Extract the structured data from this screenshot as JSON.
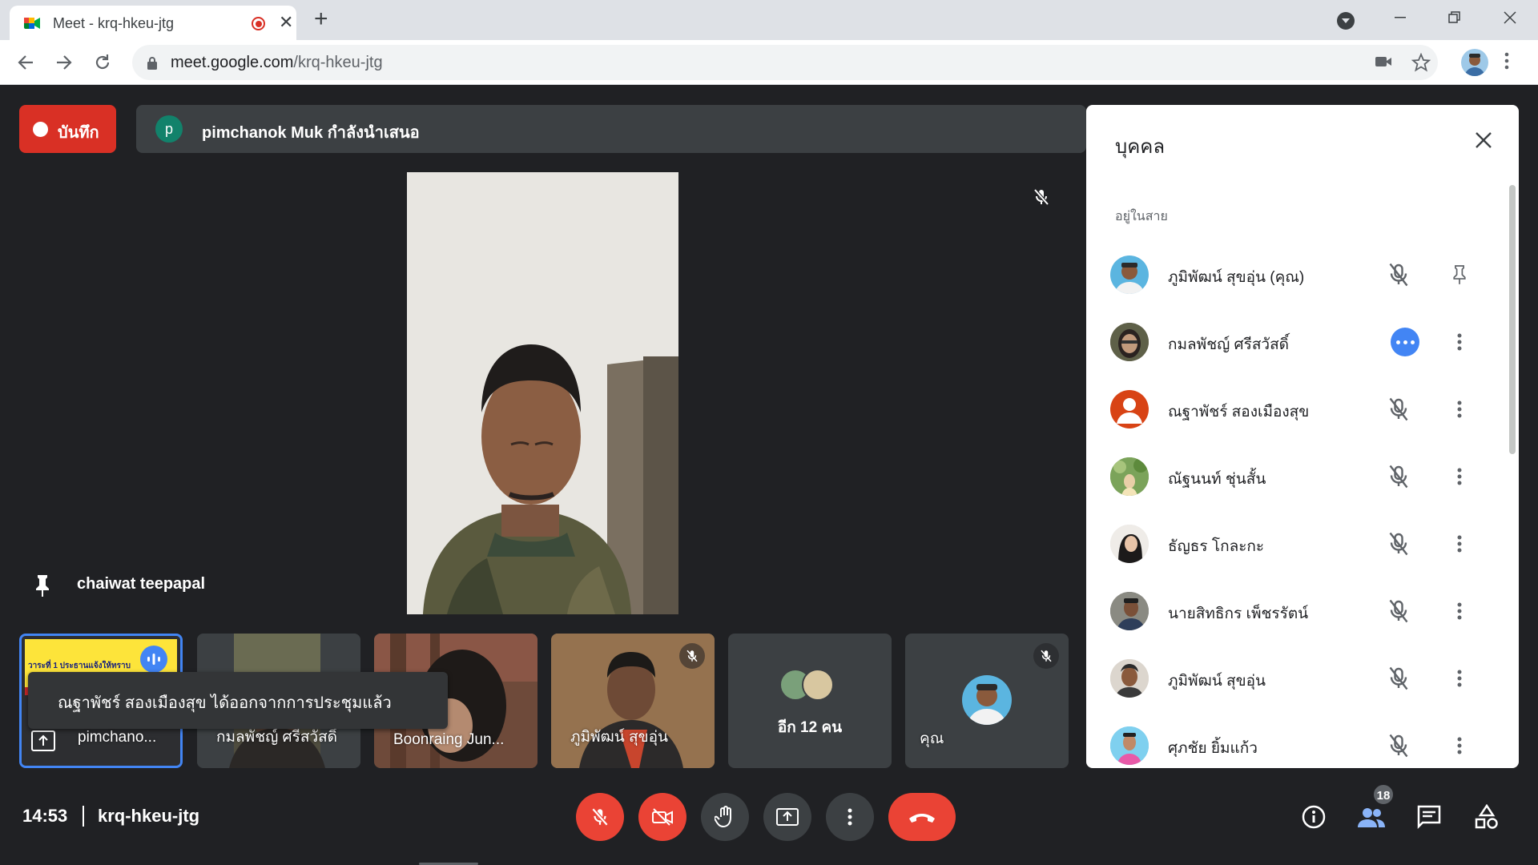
{
  "browser": {
    "tab_title": "Meet - krq-hkeu-jtg",
    "url_host": "meet.google.com",
    "url_path": "/krq-hkeu-jtg"
  },
  "meet": {
    "record_label": "บันทึก",
    "presenter_initial": "p",
    "presenter_banner": "pimchanok Muk กำลังนำเสนอ",
    "pinned_speaker": "chaiwat teepapal",
    "toast": "ณฐาพัชร์ สองเมืองสุข ได้ออกจากการประชุมแล้ว",
    "tiles": [
      {
        "name": "pimchano..."
      },
      {
        "name": "กมลพัชญ์ ศรีสวัสดิ์"
      },
      {
        "name": "Boonraing Jun..."
      },
      {
        "name": "ภูมิพัฒน์ สุขอุ่น"
      },
      {
        "name": "อีก 12 คน"
      },
      {
        "name": "คุณ"
      }
    ],
    "slide_caption": "วาระที่ 1 ประธานแจ้งให้ทราบ",
    "clock": "14:53",
    "meeting_code": "krq-hkeu-jtg",
    "participant_count": "18"
  },
  "people_panel": {
    "title": "บุคคล",
    "section": "อยู่ในสาย",
    "people": [
      {
        "name": "ภูมิพัฒน์ สุขอุ่น (คุณ)"
      },
      {
        "name": "กมลพัชญ์ ศรีสวัสดิ์"
      },
      {
        "name": "ณฐาพัชร์ สองเมืองสุข"
      },
      {
        "name": "ณัฐนนท์ ชุ่นสั้น"
      },
      {
        "name": "ธัญธร โกละกะ"
      },
      {
        "name": "นายสิทธิกร เพ็ชรรัตน์"
      },
      {
        "name": "ภูมิพัฒน์ สุขอุ่น"
      },
      {
        "name": "ศุภชัย ยิ้มแก้ว"
      }
    ]
  },
  "colors": {
    "meet_bg": "#202124",
    "record_red": "#d93025",
    "end_call_red": "#ea4335",
    "accent_blue": "#4285f4",
    "tile_gray": "#3c4043"
  }
}
